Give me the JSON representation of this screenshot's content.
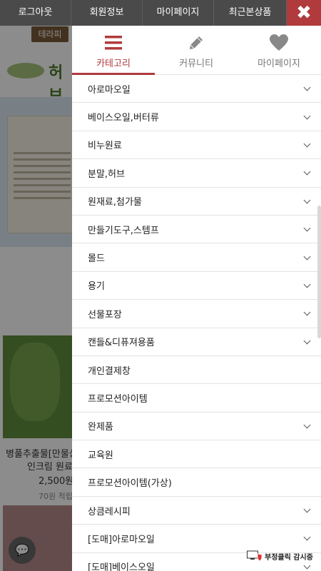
{
  "topbar": {
    "items": [
      {
        "label": "로그아웃"
      },
      {
        "label": "회원정보"
      },
      {
        "label": "마이페이지"
      },
      {
        "label": "최근본상품"
      }
    ],
    "close_symbol": "✖"
  },
  "background": {
    "logo_text": "테라피",
    "brand_text": "허브",
    "product_name_line1": "병풀추출물[만물상",
    "product_name_line2": "인크림 원료",
    "product_price": "2,500원",
    "product_points": "70원 적립"
  },
  "panel": {
    "tabs": [
      {
        "label": "카테고리",
        "icon": "hamburger-menu-icon",
        "active": true
      },
      {
        "label": "커뮤니티",
        "icon": "pencil-icon",
        "active": false
      },
      {
        "label": "마이페이지",
        "icon": "heart-icon",
        "active": false
      }
    ],
    "categories": [
      {
        "label": "아로마오일",
        "expandable": true
      },
      {
        "label": "베이스오일,버터류",
        "expandable": true
      },
      {
        "label": "비누원료",
        "expandable": true
      },
      {
        "label": "분말,허브",
        "expandable": true
      },
      {
        "label": "원재료,첨가물",
        "expandable": true
      },
      {
        "label": "만들기도구,스템프",
        "expandable": true
      },
      {
        "label": "몰드",
        "expandable": true
      },
      {
        "label": "용기",
        "expandable": true
      },
      {
        "label": "선물포장",
        "expandable": true
      },
      {
        "label": "캔들&디퓨져용품",
        "expandable": true
      },
      {
        "label": "개인결제창",
        "expandable": false
      },
      {
        "label": "프로모션아이템",
        "expandable": false
      },
      {
        "label": "완제품",
        "expandable": true
      },
      {
        "label": "교육원",
        "expandable": false
      },
      {
        "label": "프로모션아이템(가상)",
        "expandable": false
      },
      {
        "label": "상큼레시피",
        "expandable": true
      },
      {
        "label": "[도매]아로마오일",
        "expandable": true
      },
      {
        "label": "[도매]베이스오일",
        "expandable": true
      }
    ]
  },
  "badge": {
    "label": "부정클릭 감시중"
  },
  "colors": {
    "accent": "#b03a3c",
    "topbar": "#4a4a4a"
  }
}
